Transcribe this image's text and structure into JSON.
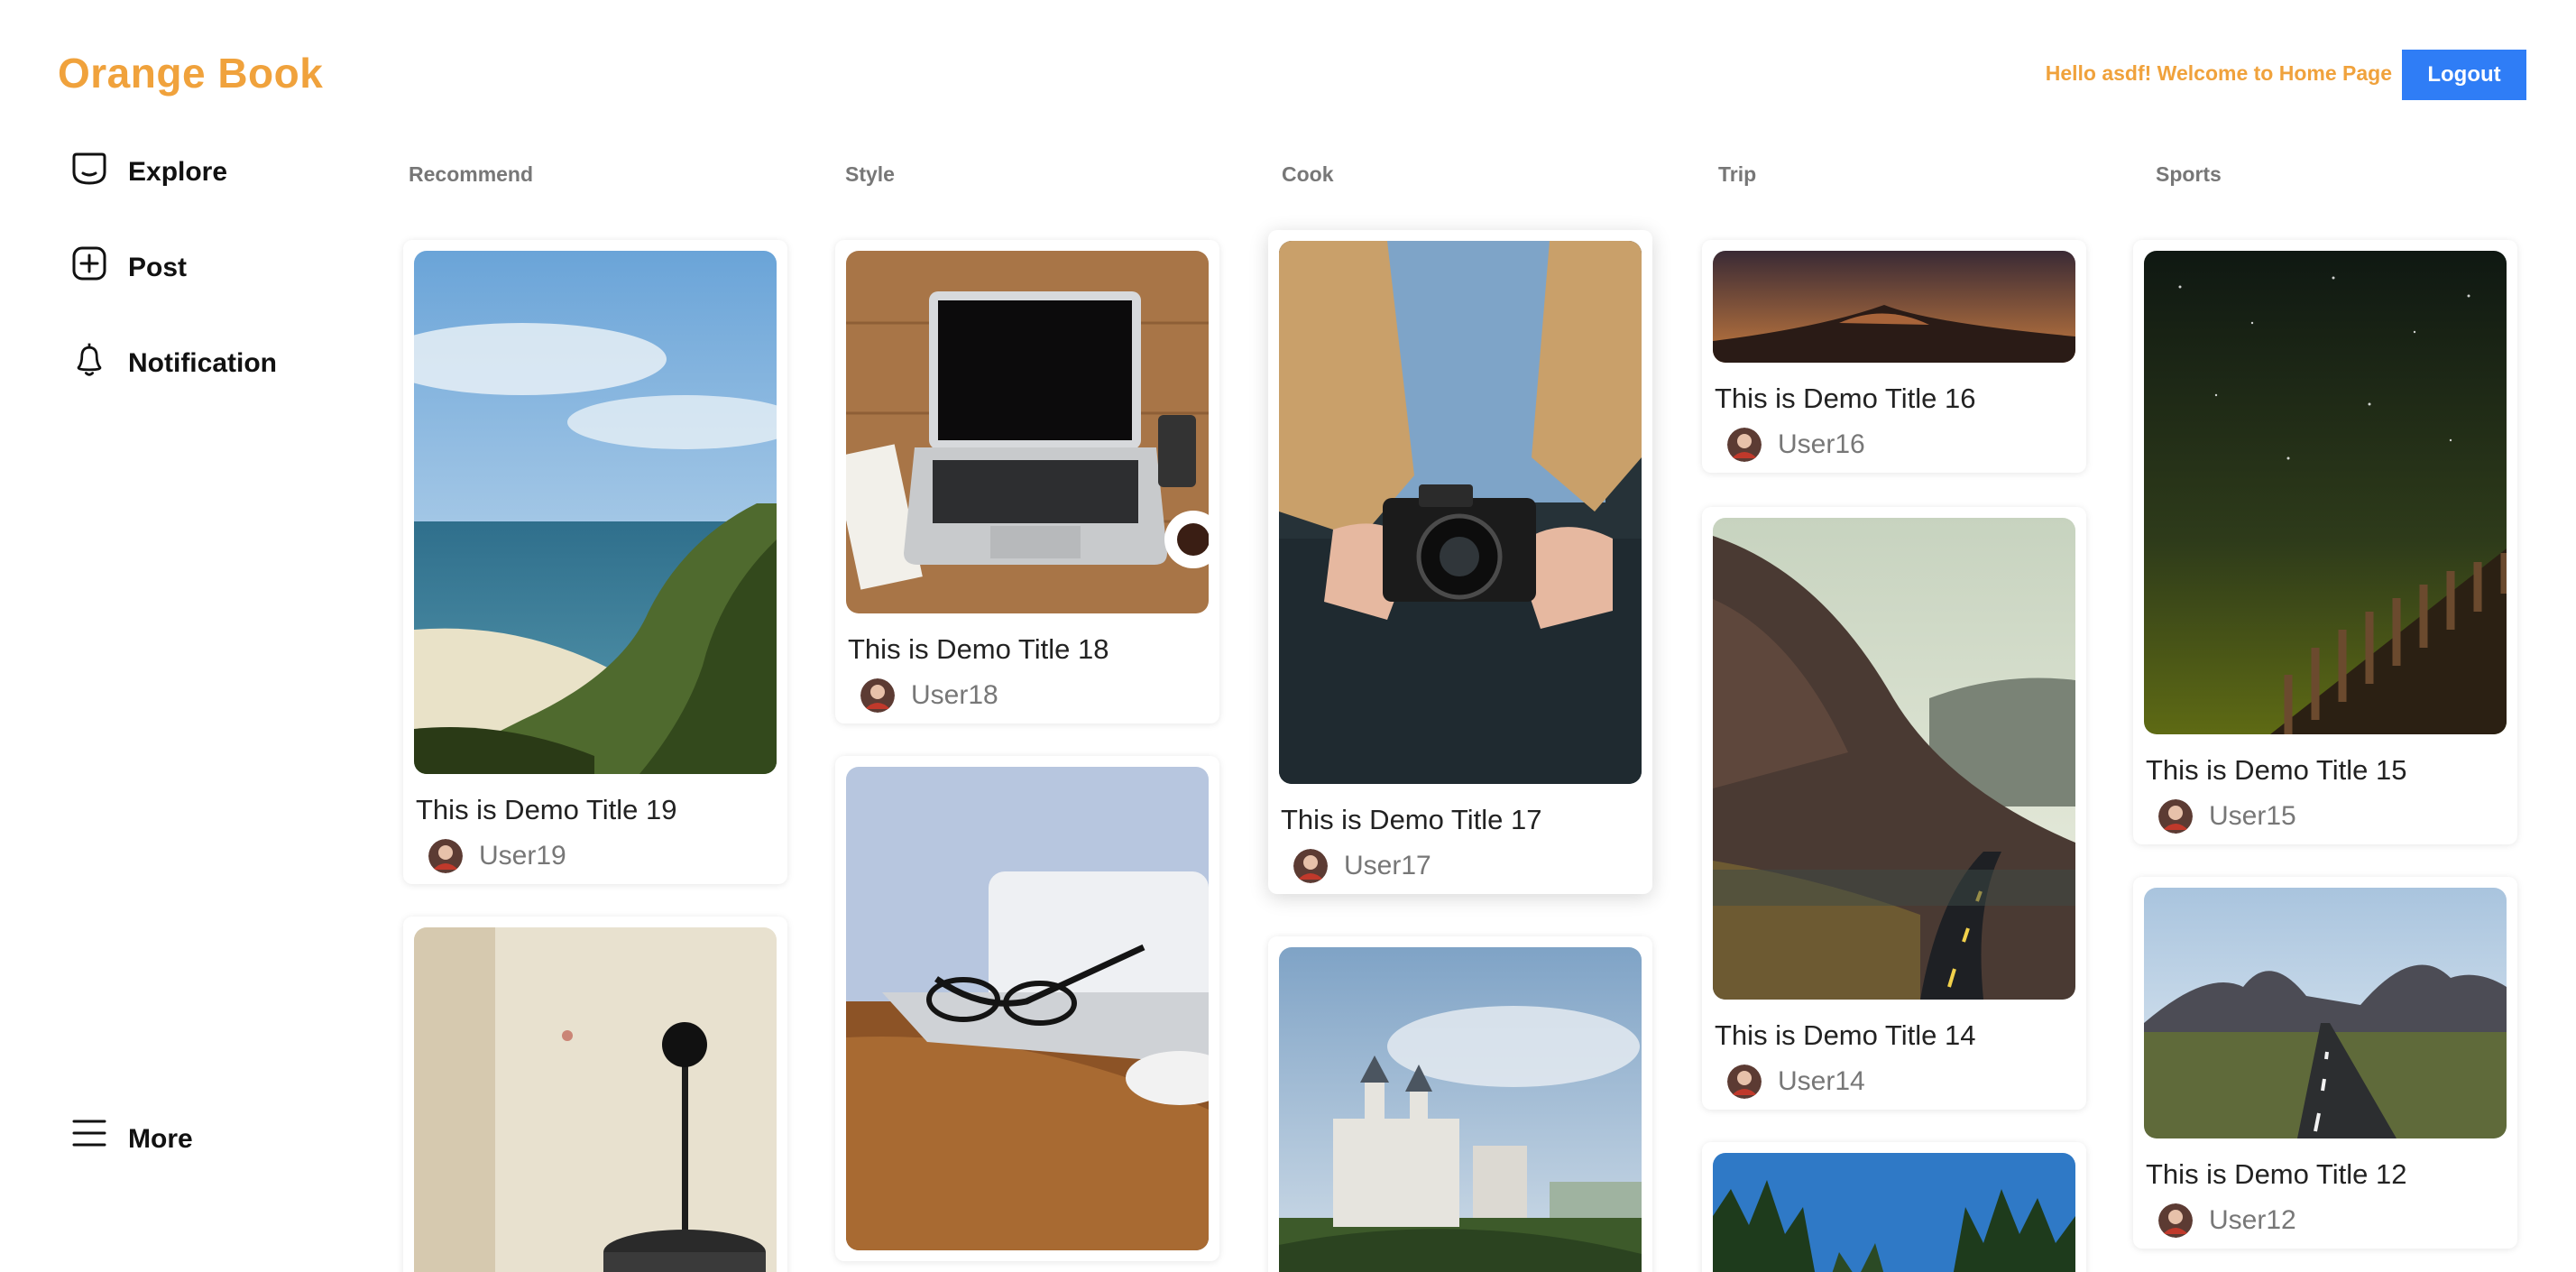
{
  "app": {
    "logo": "Orange Book",
    "welcome": "Hello asdf! Welcome to Home Page",
    "logout_label": "Logout"
  },
  "nav": {
    "explore": "Explore",
    "post": "Post",
    "notification": "Notification",
    "more": "More"
  },
  "icons": {
    "explore": "explore-icon",
    "post": "plus-square-icon",
    "notification": "bell-icon",
    "more": "menu-icon"
  },
  "colors": {
    "brand": "#f0a23c",
    "logout": "#2f7df6",
    "category": "#777777"
  },
  "categories": [
    "Recommend",
    "Style",
    "Cook",
    "Trip",
    "Sports"
  ],
  "cards": [
    {
      "title": "This is Demo Title 19",
      "user": "User19"
    },
    {
      "title": "This is Demo Title 18",
      "user": "User18"
    },
    {
      "title": "This is Demo Title 17",
      "user": "User17"
    },
    {
      "title": "This is Demo Title 16",
      "user": "User16"
    },
    {
      "title": "This is Demo Title 15",
      "user": "User15"
    },
    {
      "title": "This is Demo Title 14",
      "user": "User14"
    },
    {
      "title": "This is Demo Title 12",
      "user": "User12"
    }
  ]
}
